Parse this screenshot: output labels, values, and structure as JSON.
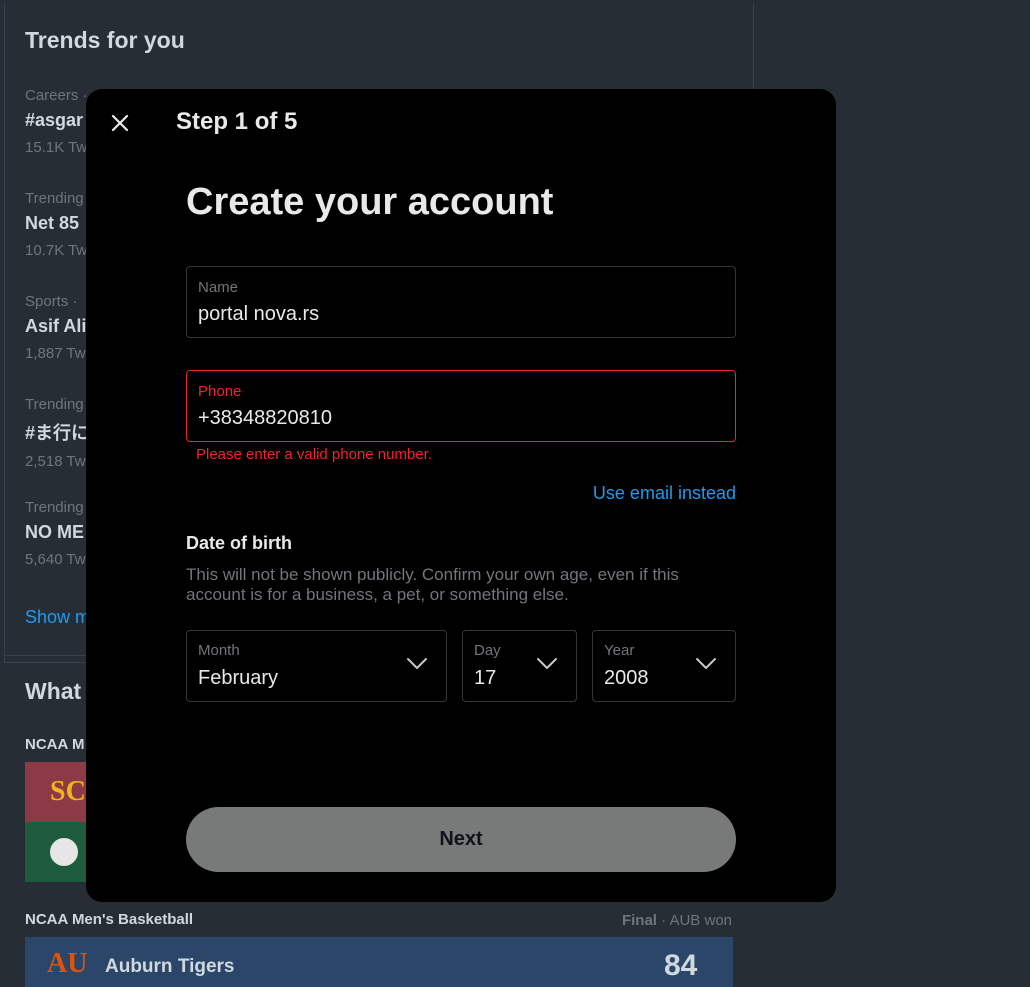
{
  "trends": {
    "title": "Trends for you",
    "items": [
      {
        "meta": "Careers · ",
        "name": "#asgar",
        "count": "15.1K Tw"
      },
      {
        "meta": "Trending",
        "name": "Net 85",
        "count": "10.7K Tw"
      },
      {
        "meta": "Sports · ",
        "name": "Asif Ali",
        "count": "1,887 Tw"
      },
      {
        "meta": "Trending",
        "name": "#ま行に",
        "count": "2,518 Tw"
      },
      {
        "meta": "Trending",
        "name": "NO ME",
        "count": "5,640 Tw"
      }
    ],
    "show_more": "Show m"
  },
  "whats_happening": {
    "title": "What",
    "event1_label": "NCAA M",
    "event2_label": "NCAA Men's Basketball",
    "event2_status": "Final",
    "event2_result": " · AUB won",
    "team_name": "Auburn Tigers",
    "team_score": "84",
    "team_logo_sc": "SC",
    "team_logo_au": "AU"
  },
  "modal": {
    "step": "Step 1 of 5",
    "title": "Create your account",
    "name_label": "Name",
    "name_value": "portal nova.rs",
    "phone_label": "Phone",
    "phone_value": "+38348820810",
    "phone_error": "Please enter a valid phone number.",
    "use_email": "Use email instead",
    "dob_heading": "Date of birth",
    "dob_note": "This will not be shown publicly. Confirm your own age, even if this account is for a business, a pet, or something else.",
    "month_label": "Month",
    "month_value": "February",
    "day_label": "Day",
    "day_value": "17",
    "year_label": "Year",
    "year_value": "2008",
    "next_label": "Next"
  },
  "colors": {
    "accent": "#1d9bf0",
    "error": "#f4212e",
    "modal_bg": "#000000",
    "page_bg": "#272d35"
  }
}
